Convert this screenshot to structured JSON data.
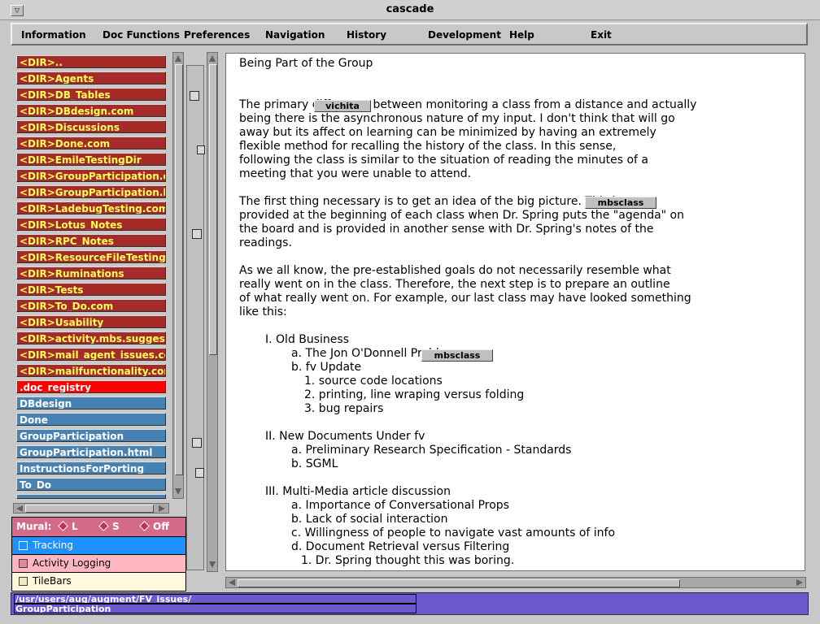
{
  "window": {
    "title": "cascade"
  },
  "menubar": [
    {
      "label": "Information"
    },
    {
      "label": "Doc Functions"
    },
    {
      "label": "Preferences"
    },
    {
      "label": "Navigation"
    },
    {
      "label": "History"
    },
    {
      "label": "Development"
    },
    {
      "label": "Help"
    },
    {
      "label": "Exit"
    }
  ],
  "files": [
    {
      "label": "<DIR>..",
      "kind": "dir"
    },
    {
      "label": "<DIR>Agents",
      "kind": "dir"
    },
    {
      "label": "<DIR>DB_Tables",
      "kind": "dir"
    },
    {
      "label": "<DIR>DBdesign.com",
      "kind": "dir"
    },
    {
      "label": "<DIR>Discussions",
      "kind": "dir"
    },
    {
      "label": "<DIR>Done.com",
      "kind": "dir"
    },
    {
      "label": "<DIR>EmileTestingDir",
      "kind": "dir"
    },
    {
      "label": "<DIR>GroupParticipation.com",
      "kind": "dir"
    },
    {
      "label": "<DIR>GroupParticipation.html.c",
      "kind": "dir"
    },
    {
      "label": "<DIR>LadebugTesting.com",
      "kind": "dir"
    },
    {
      "label": "<DIR>Lotus_Notes",
      "kind": "dir"
    },
    {
      "label": "<DIR>RPC_Notes",
      "kind": "dir"
    },
    {
      "label": "<DIR>ResourceFileTesting.com",
      "kind": "dir"
    },
    {
      "label": "<DIR>Ruminations",
      "kind": "dir"
    },
    {
      "label": "<DIR>Tests",
      "kind": "dir"
    },
    {
      "label": "<DIR>To_Do.com",
      "kind": "dir"
    },
    {
      "label": "<DIR>Usability",
      "kind": "dir"
    },
    {
      "label": "<DIR>activity.mbs.suggestions",
      "kind": "dir"
    },
    {
      "label": "<DIR>mail_agent_issues.com",
      "kind": "dir"
    },
    {
      "label": "<DIR>mailfunctionality.com",
      "kind": "dir"
    },
    {
      "label": ".doc_registry",
      "kind": "sel"
    },
    {
      "label": "DBdesign",
      "kind": "file"
    },
    {
      "label": "Done",
      "kind": "file"
    },
    {
      "label": "GroupParticipation",
      "kind": "file"
    },
    {
      "label": "GroupParticipation.html",
      "kind": "file"
    },
    {
      "label": "InstructionsForPorting",
      "kind": "file"
    },
    {
      "label": "To_Do",
      "kind": "file"
    }
  ],
  "mural": {
    "label": "Mural:",
    "options": [
      {
        "label": "L"
      },
      {
        "label": "S"
      },
      {
        "label": "Off"
      }
    ]
  },
  "toggles": [
    {
      "label": "Tracking",
      "bg": "#1e90ff",
      "fg": "#ffffff"
    },
    {
      "label": "Activity Logging",
      "bg": "#ffb6c1",
      "fg": "#000000"
    },
    {
      "label": "TileBars",
      "bg": "#fff8dc",
      "fg": "#000000"
    }
  ],
  "document": {
    "heading": "Being Part of the Group",
    "lines": [
      "The primary                   difference between monitoring a class from a distance and actually",
      "being there is the asynchronous nature of my input.  I don't think that will go",
      "away but its affect on  learning  can be minimized by having an extremely",
      "  flexible method for recalling  the history  of  the class.  In this sense,",
      "following the class is similar  to the situation of reading the minutes of a",
      "meeting  that you were  unable to attend.",
      "The first thing necessary is to get an idea of the big picture.                         This is",
      "provided at the beginning of each class when Dr. Spring puts the \"agenda\" on",
      "the board and is provided in another   sense with Dr. Spring's notes of the",
      "  readings.",
      "As we all know, the pre-established goals do not necessarily resemble what",
      "really went  on in the class.  Therefore, the next step is to prepare an outline",
      "of what really went on.  For example, our last class may have looked something",
      "like this:",
      "I.  Old  Business",
      "a.  The Jon O'Donnell                      Problem",
      "b.  fv Update",
      "1. source code locations",
      "2. printing, line wraping versus folding",
      "3. bug repairs",
      "II.  New Documents  Under fv",
      "a. Preliminary Research Specification - Standards",
      "b. SGML",
      "III. Multi-Media article discussion",
      "a. Importance of Conversational Props",
      "b. Lack of social  interaction",
      "c. Willingness  of people to navigate vast amounts of info",
      "d. Document Retrieval versus Filtering",
      "1. Dr. Spring thought this was  boring."
    ],
    "tags": [
      {
        "label": "vichita"
      },
      {
        "label": "mbsclass"
      },
      {
        "label": "mbsclass"
      }
    ]
  },
  "status": {
    "path": "/usr/users/aug/augment/FV_issues/",
    "file": "GroupParticipation"
  }
}
